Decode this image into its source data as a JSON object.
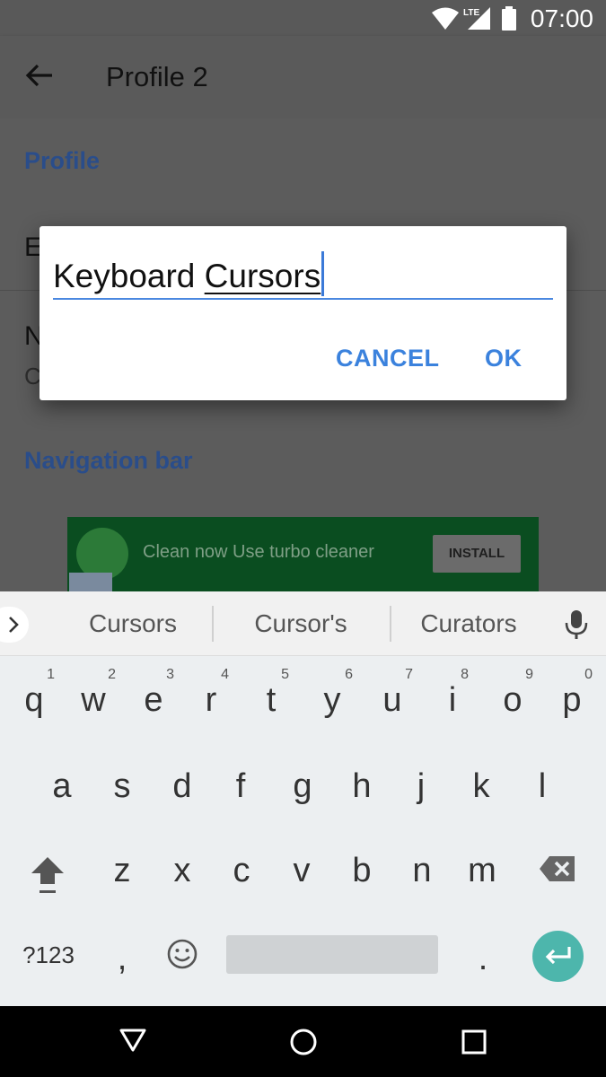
{
  "status_bar": {
    "time": "07:00",
    "network": "LTE"
  },
  "app_bar": {
    "title": "Profile 2"
  },
  "settings": {
    "section_profile": "Profile",
    "row1_title_visible": "E",
    "row2_title_visible": "N",
    "row2_sub_visible": "C",
    "section_navigation": "Navigation bar"
  },
  "ad": {
    "text": "Clean now Use turbo cleaner",
    "install_label": "INSTALL"
  },
  "dialog": {
    "input_text_plain": "Keyboard ",
    "input_text_composing": "Cursors",
    "cancel_label": "CANCEL",
    "ok_label": "OK"
  },
  "suggestions": [
    "Cursors",
    "Cursor's",
    "Curators"
  ],
  "keyboard": {
    "row1": [
      {
        "k": "q",
        "h": "1"
      },
      {
        "k": "w",
        "h": "2"
      },
      {
        "k": "e",
        "h": "3"
      },
      {
        "k": "r",
        "h": "4"
      },
      {
        "k": "t",
        "h": "5"
      },
      {
        "k": "y",
        "h": "6"
      },
      {
        "k": "u",
        "h": "7"
      },
      {
        "k": "i",
        "h": "8"
      },
      {
        "k": "o",
        "h": "9"
      },
      {
        "k": "p",
        "h": "0"
      }
    ],
    "row2": [
      "a",
      "s",
      "d",
      "f",
      "g",
      "h",
      "j",
      "k",
      "l"
    ],
    "row3": [
      "z",
      "x",
      "c",
      "v",
      "b",
      "n",
      "m"
    ],
    "symbols_label": "?123",
    "comma": ",",
    "period": "."
  },
  "colors": {
    "accent": "#4a88e0",
    "enter": "#4db6ac",
    "ad_bg": "#0a4d20"
  }
}
